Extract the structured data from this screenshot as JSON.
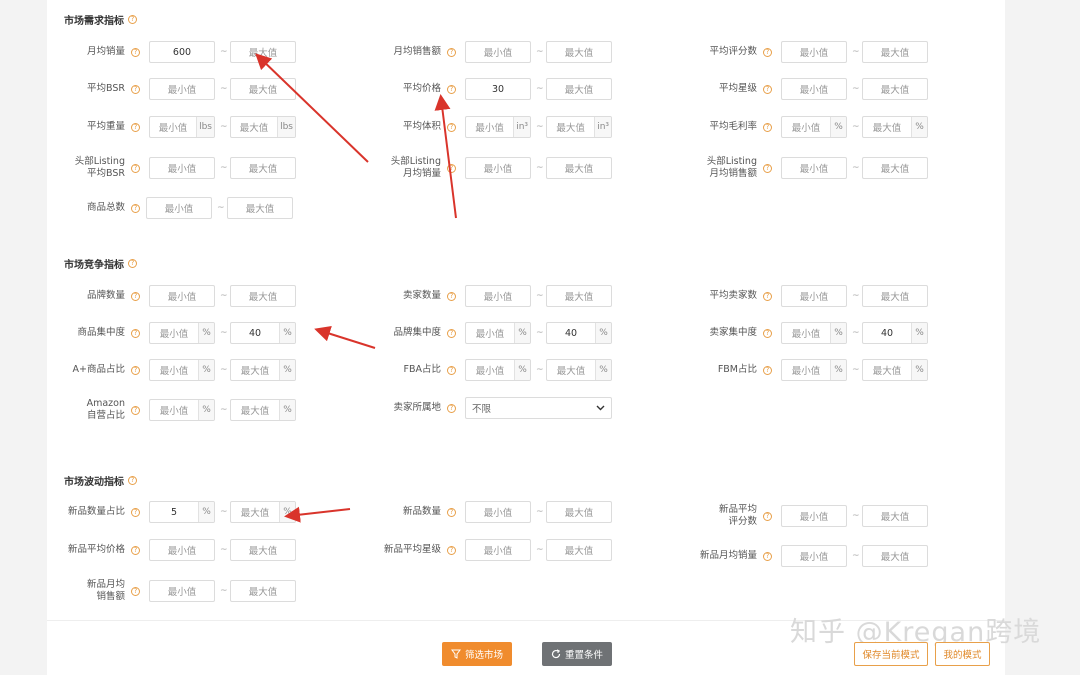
{
  "sections": {
    "demand": "市场需求指标",
    "competition": "市场竞争指标",
    "volatility": "市场波动指标"
  },
  "common": {
    "min": "最小值",
    "max": "最大值",
    "tilde": "~",
    "pct": "%",
    "lbs": "lbs",
    "in3": "in³",
    "help": "?"
  },
  "demand": {
    "monthly_sales": {
      "label": "月均销量",
      "min": "600"
    },
    "monthly_revenue": {
      "label": "月均销售额"
    },
    "avg_rating_count": {
      "label": "平均评分数"
    },
    "avg_bsr": {
      "label": "平均BSR"
    },
    "avg_price": {
      "label": "平均价格",
      "min": "30"
    },
    "avg_star": {
      "label": "平均星级"
    },
    "avg_weight": {
      "label": "平均重量"
    },
    "avg_volume": {
      "label": "平均体积"
    },
    "avg_margin": {
      "label": "平均毛利率"
    },
    "top_listing_bsr": {
      "label": "头部Listing\n平均BSR"
    },
    "top_listing_sales": {
      "label": "头部Listing\n月均销量"
    },
    "top_listing_revenue": {
      "label": "头部Listing\n月均销售额"
    },
    "product_total": {
      "label": "商品总数"
    }
  },
  "competition": {
    "brand_count": {
      "label": "品牌数量"
    },
    "seller_count": {
      "label": "卖家数量"
    },
    "avg_seller_count": {
      "label": "平均卖家数"
    },
    "product_concentration": {
      "label": "商品集中度",
      "max": "40"
    },
    "brand_concentration": {
      "label": "品牌集中度",
      "max": "40"
    },
    "seller_concentration": {
      "label": "卖家集中度",
      "max": "40"
    },
    "aplus_ratio": {
      "label": "A+商品占比"
    },
    "fba_ratio": {
      "label": "FBA占比"
    },
    "fbm_ratio": {
      "label": "FBM占比"
    },
    "amazon_ratio": {
      "label": "Amazon\n自营占比"
    },
    "seller_location": {
      "label": "卖家所属地",
      "value": "不限"
    }
  },
  "volatility": {
    "new_count_ratio": {
      "label": "新品数量占比",
      "min": "5"
    },
    "new_count": {
      "label": "新品数量"
    },
    "new_avg_rating_count": {
      "label": "新品平均\n评分数"
    },
    "new_avg_price": {
      "label": "新品平均价格"
    },
    "new_avg_star": {
      "label": "新品平均星级"
    },
    "new_monthly_sales": {
      "label": "新品月均销量"
    },
    "new_monthly_revenue": {
      "label": "新品月均\n销售额"
    }
  },
  "buttons": {
    "filter": "筛选市场",
    "reset": "重置条件",
    "save_mode": "保存当前模式",
    "my_mode": "我的模式"
  },
  "watermark": "知乎 @Kregan跨境",
  "colors": {
    "accent": "#f08c2e",
    "arrow": "#d9342b"
  }
}
